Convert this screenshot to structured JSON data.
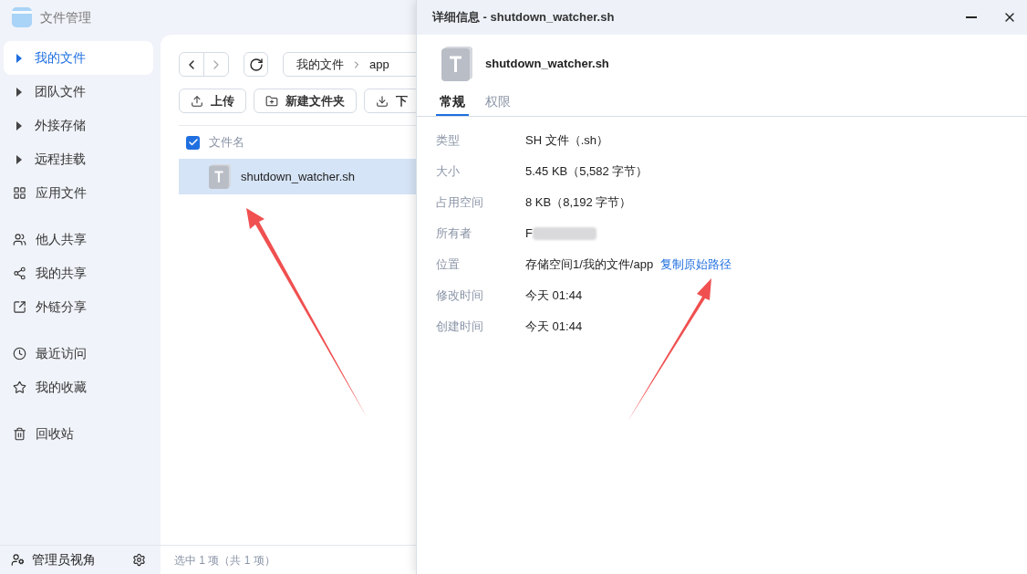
{
  "app": {
    "title": "文件管理"
  },
  "sidebar": {
    "sections": [
      [
        {
          "label": "我的文件",
          "kind": "expandable",
          "selected": true
        },
        {
          "label": "团队文件",
          "kind": "expandable",
          "selected": false
        },
        {
          "label": "外接存储",
          "kind": "expandable",
          "selected": false
        },
        {
          "label": "远程挂载",
          "kind": "expandable",
          "selected": false
        },
        {
          "label": "应用文件",
          "kind": "apps",
          "selected": false
        }
      ],
      [
        {
          "label": "他人共享",
          "kind": "people",
          "selected": false
        },
        {
          "label": "我的共享",
          "kind": "share",
          "selected": false
        },
        {
          "label": "外链分享",
          "kind": "link",
          "selected": false
        }
      ],
      [
        {
          "label": "最近访问",
          "kind": "clock",
          "selected": false
        },
        {
          "label": "我的收藏",
          "kind": "star",
          "selected": false
        }
      ],
      [
        {
          "label": "回收站",
          "kind": "trash",
          "selected": false
        }
      ]
    ],
    "footer": {
      "label": "管理员视角"
    }
  },
  "breadcrumb": [
    "我的文件",
    "app"
  ],
  "toolbar": [
    {
      "label": "上传",
      "kind": "upload"
    },
    {
      "label": "新建文件夹",
      "kind": "folder"
    },
    {
      "label": "下",
      "kind": "download"
    }
  ],
  "file_list": {
    "header": {
      "label": "文件名",
      "checked": true
    },
    "rows": [
      {
        "name": "shutdown_watcher.sh",
        "selected": true
      }
    ]
  },
  "status_bar": "选中 1 项（共 1 项）",
  "details_window": {
    "title": "详细信息 - shutdown_watcher.sh",
    "file_name": "shutdown_watcher.sh",
    "tabs": [
      {
        "label": "常规",
        "selected": true
      },
      {
        "label": "权限",
        "selected": false
      }
    ],
    "properties": [
      {
        "label": "类型",
        "value": "SH 文件（.sh）"
      },
      {
        "label": "大小",
        "value": "5.45 KB（5,582 字节）"
      },
      {
        "label": "占用空间",
        "value": "8 KB（8,192 字节）"
      },
      {
        "label": "所有者",
        "value": "F",
        "redacted": true
      },
      {
        "label": "位置",
        "value": "存储空间1/我的文件/app",
        "link": "复制原始路径"
      },
      {
        "label": "修改时间",
        "value": "今天 01:44"
      },
      {
        "label": "创建时间",
        "value": "今天 01:44"
      }
    ]
  }
}
